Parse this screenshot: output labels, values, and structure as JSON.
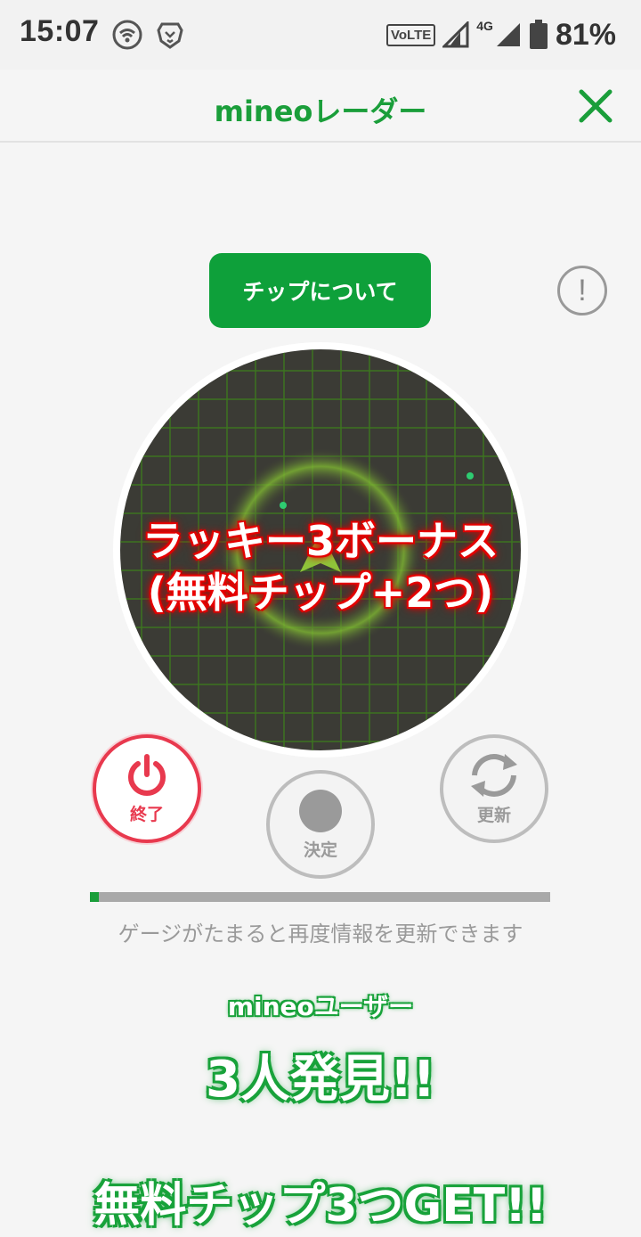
{
  "status_bar": {
    "time": "15:07",
    "volte": "VoLTE",
    "network": "4G",
    "battery": "81%"
  },
  "header": {
    "title": "mineoレーダー"
  },
  "chip_button": "チップについて",
  "info_button": "!",
  "radar": {
    "bonus_line1": "ラッキー3ボーナス",
    "bonus_line2": "(無料チップ+2つ)"
  },
  "buttons": {
    "end": "終了",
    "decide": "決定",
    "update": "更新"
  },
  "gauge": {
    "progress": 0.02,
    "text": "ゲージがたまると再度情報を更新できます"
  },
  "result": {
    "label": "mineoユーザー",
    "count": "3人発見!!",
    "chips": "無料チップ3つGET!!"
  },
  "colors": {
    "brand_green": "#1a9e3a",
    "end_red": "#e8394e",
    "bonus_red": "#dd0000"
  }
}
